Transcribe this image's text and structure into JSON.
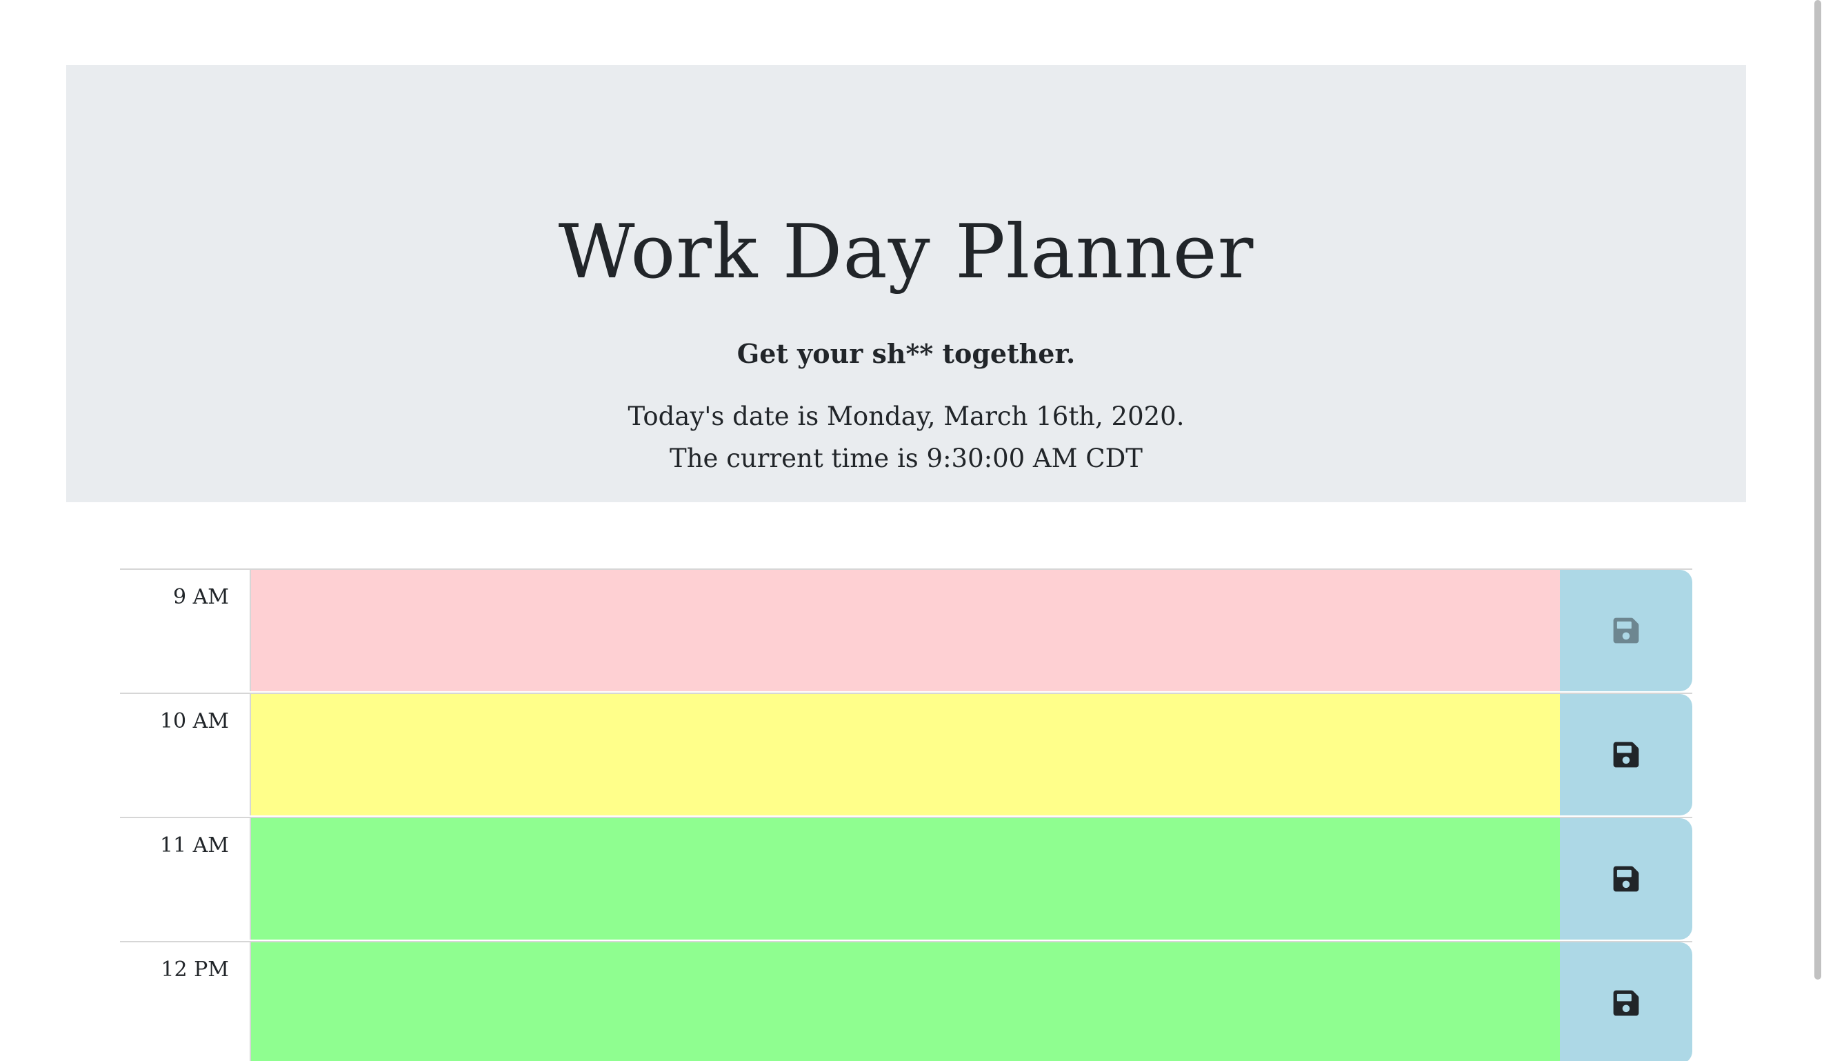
{
  "header": {
    "title": "Work Day Planner",
    "tagline": "Get your sh** together.",
    "date_prefix": "Today's date is ",
    "date_value": "Monday, March 16th, 2020",
    "date_suffix": ".",
    "time_prefix": "The current time is ",
    "time_value": "9:30:00 AM CDT"
  },
  "timeblocks": [
    {
      "hour": "9 AM",
      "status": "past",
      "text": ""
    },
    {
      "hour": "10 AM",
      "status": "present",
      "text": ""
    },
    {
      "hour": "11 AM",
      "status": "future",
      "text": ""
    },
    {
      "hour": "12 PM",
      "status": "future",
      "text": ""
    }
  ],
  "colors": {
    "past": "#fed0d3",
    "present": "#ffff8a",
    "future": "#8ffe90",
    "save_button": "#add8e6",
    "jumbotron": "#e9ecef"
  },
  "icons": {
    "save": "floppy-disk-icon"
  }
}
